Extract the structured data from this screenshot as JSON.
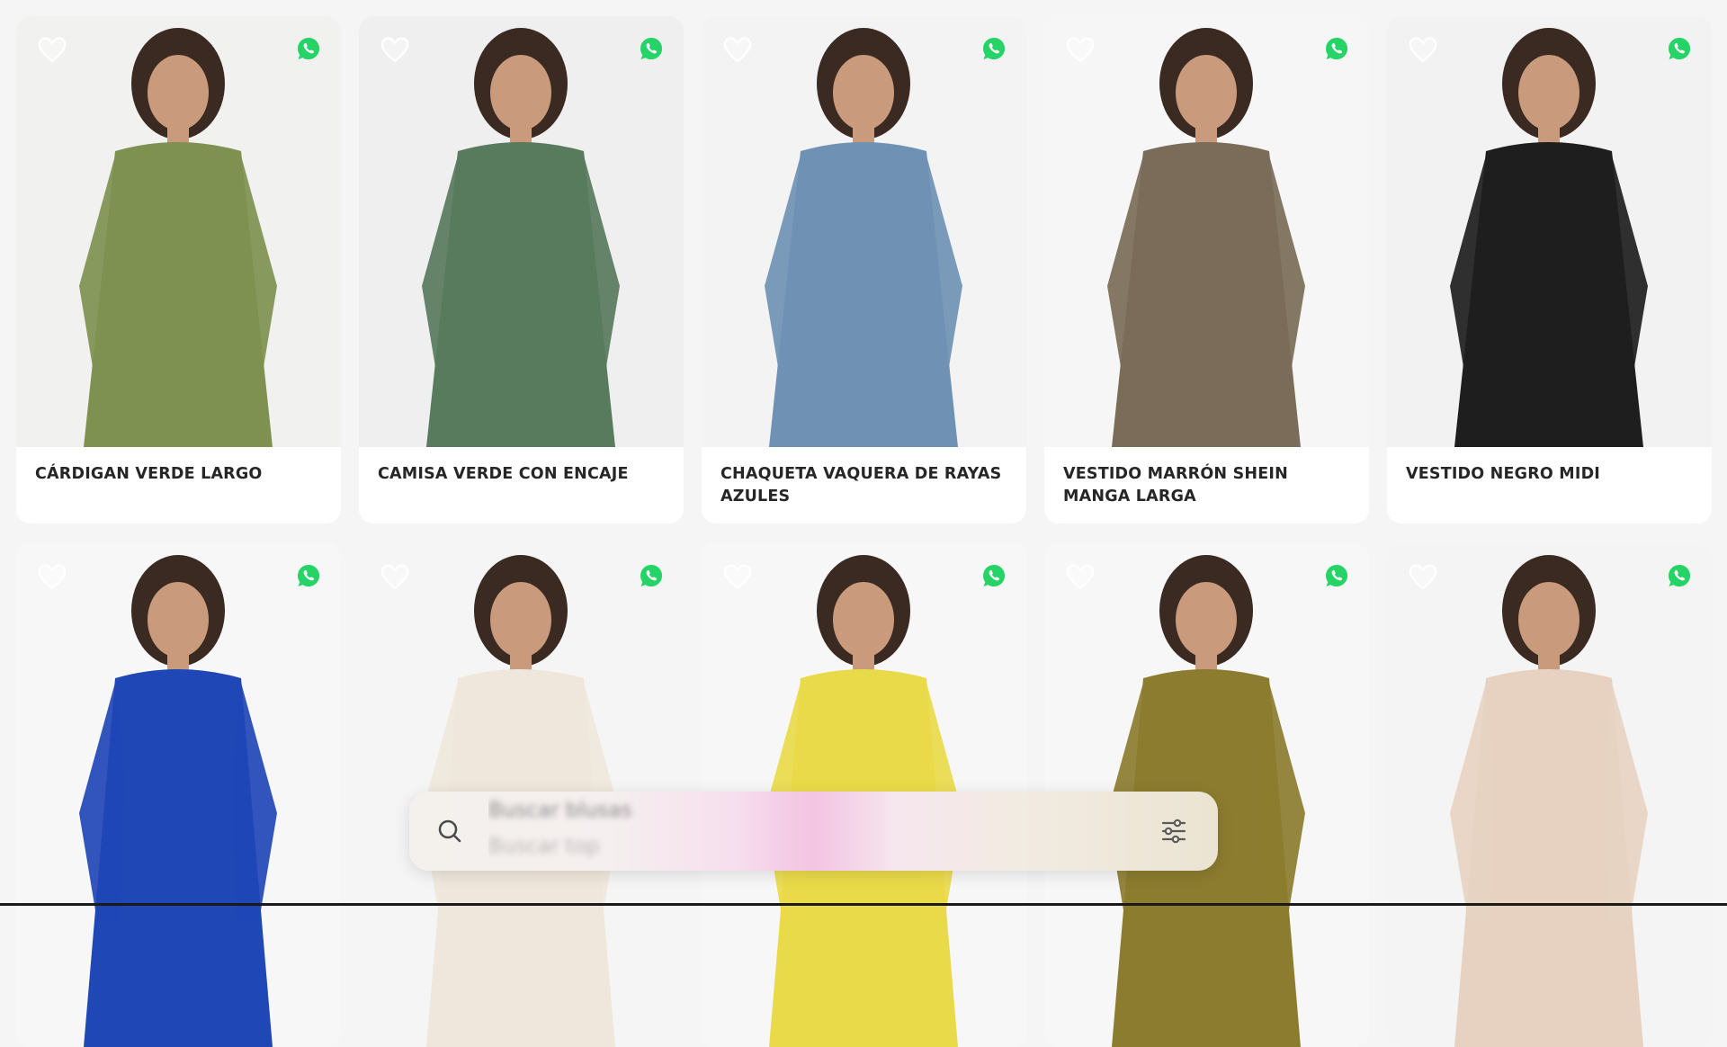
{
  "products": [
    {
      "title": "CÁRDIGAN VERDE LARGO",
      "garment": "#7f9150",
      "bg": "#f1f1ef"
    },
    {
      "title": "CAMISA VERDE CON ENCAJE",
      "garment": "#587a5d",
      "bg": "#efefef"
    },
    {
      "title": "CHAQUETA VAQUERA DE RAYAS AZULES",
      "garment": "#6f92b4",
      "bg": "#f3f3f3"
    },
    {
      "title": "VESTIDO MARRÓN SHEIN MANGA LARGA",
      "garment": "#7a6c58",
      "bg": "#f6f6f6"
    },
    {
      "title": "VESTIDO NEGRO MIDI",
      "garment": "#1e1e1e",
      "bg": "#f2f2f2"
    },
    {
      "title": "",
      "garment": "#1f47b6",
      "bg": "#f7f7f7"
    },
    {
      "title": "",
      "garment": "#efe7db",
      "bg": "#f5f5f5"
    },
    {
      "title": "",
      "garment": "#e9da4a",
      "bg": "#f7f7f7"
    },
    {
      "title": "",
      "garment": "#8b7c2f",
      "bg": "#f7f7f7"
    },
    {
      "title": "",
      "garment": "#e7d2c1",
      "bg": "#f4f4f4"
    }
  ],
  "icons": {
    "favorite": "heart-outline-icon",
    "share": "whatsapp-icon",
    "search": "search-icon",
    "filters": "sliders-icon"
  },
  "colors": {
    "whatsapp": "#25d366",
    "title_text": "#262626"
  },
  "search": {
    "placeholder_primary": "Buscar blusas",
    "placeholder_secondary": "Buscar top"
  }
}
